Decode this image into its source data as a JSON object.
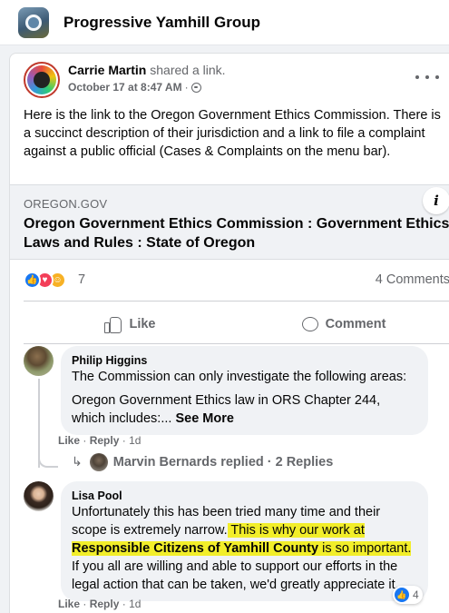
{
  "group": {
    "name": "Progressive Yamhill Group"
  },
  "post": {
    "author": "Carrie Martin",
    "action": "shared a link.",
    "timestamp": "October 17 at 8:47 AM",
    "separator": "·",
    "text": "Here is the link to the Oregon Government Ethics Commission. There is a succinct description of their jurisdiction and a link to file a complaint against a public official (Cases & Complaints on the menu bar).",
    "link": {
      "domain": "OREGON.GOV",
      "title": "Oregon Government Ethics Commission : Government Ethics Laws and Rules : State of Oregon",
      "info_icon": "i"
    },
    "reactions": {
      "count": "7",
      "types": [
        "like-icon",
        "love-icon",
        "care-icon"
      ]
    },
    "comment_count": "4 Comments",
    "actions": {
      "like": "Like",
      "comment": "Comment"
    }
  },
  "comments": [
    {
      "name": "Philip Higgins",
      "text1": "The Commission can only investigate the following areas:",
      "text2": "Oregon Government Ethics law in ORS Chapter 244, which includes:... ",
      "see_more": "See More",
      "like": "Like",
      "reply": "Reply",
      "age": "1d",
      "dot": "·"
    },
    {
      "name": "Lisa Pool",
      "text_a": "Unfortunately this has been tried many time and their scope is extremely narrow.",
      "text_b": " This is why our work at ",
      "text_c": "Responsible Citizens of Yamhill County",
      "text_d": " is so important.",
      "text_e": "If you all are willing and able to support our efforts in the legal action that can be taken, we'd greatly appreciate it.",
      "like": "Like",
      "reply": "Reply",
      "age": "1d",
      "dot": "·",
      "reaction_count": "4"
    }
  ],
  "replies": {
    "arrow": "↳",
    "text": "Marvin Bernards replied · 2 Replies"
  },
  "colors": {
    "accent": "#1877f2",
    "highlight": "#f2ee2a"
  }
}
